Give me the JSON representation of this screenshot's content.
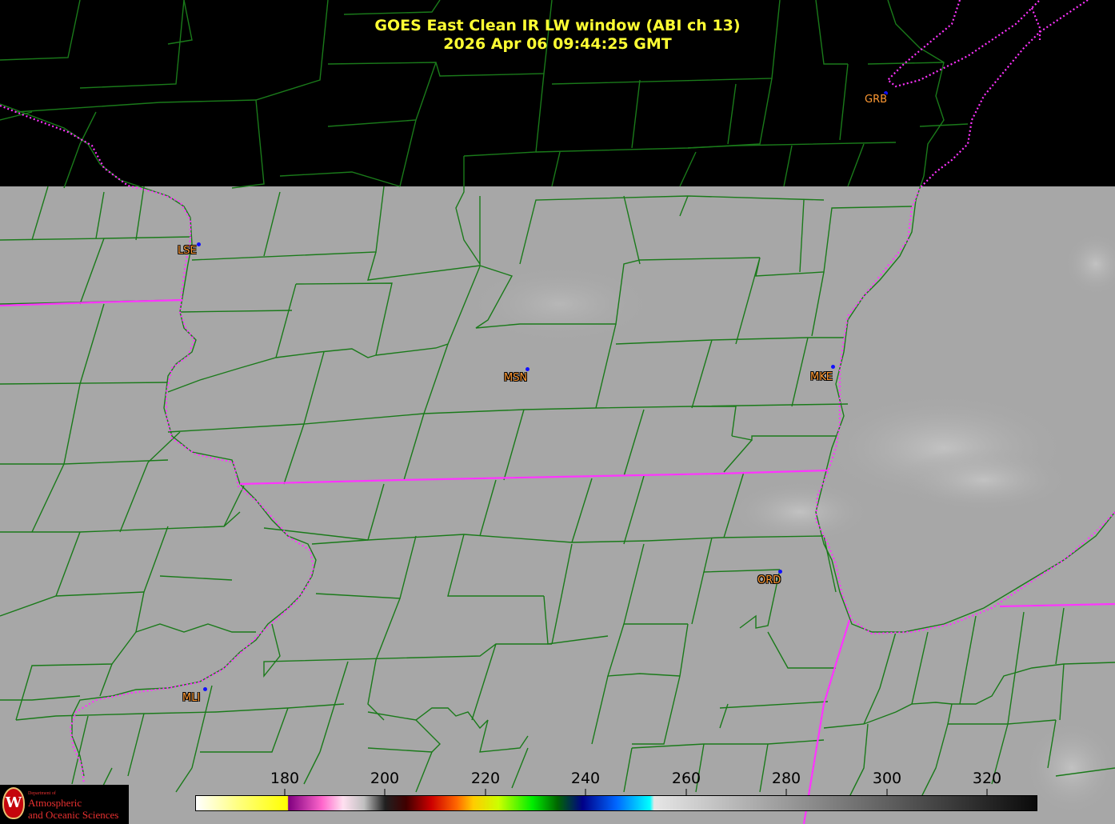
{
  "title": {
    "line1": "GOES East Clean IR LW window (ABI ch 13)",
    "line2": "2026 Apr 06  09:44:25 GMT"
  },
  "stations": [
    {
      "code": "GRB"
    },
    {
      "code": "LSE"
    },
    {
      "code": "MSN"
    },
    {
      "code": "MKE"
    },
    {
      "code": "ORD"
    },
    {
      "code": "MLI"
    }
  ],
  "colorbar": {
    "ticks": [
      "180",
      "200",
      "220",
      "240",
      "260",
      "280",
      "300",
      "320"
    ]
  },
  "logo": {
    "line1": "Department of",
    "line2": "Atmospheric",
    "line3": "and Oceanic Sciences"
  },
  "colors": {
    "title": "#ffff33",
    "county_lines": "#1a7a1a",
    "state_lines": "#ff33ff",
    "station_label": "#ff9933",
    "station_dot": "#1010ff",
    "land_gray": "#a6a6a6",
    "nodata_black": "#000000"
  }
}
